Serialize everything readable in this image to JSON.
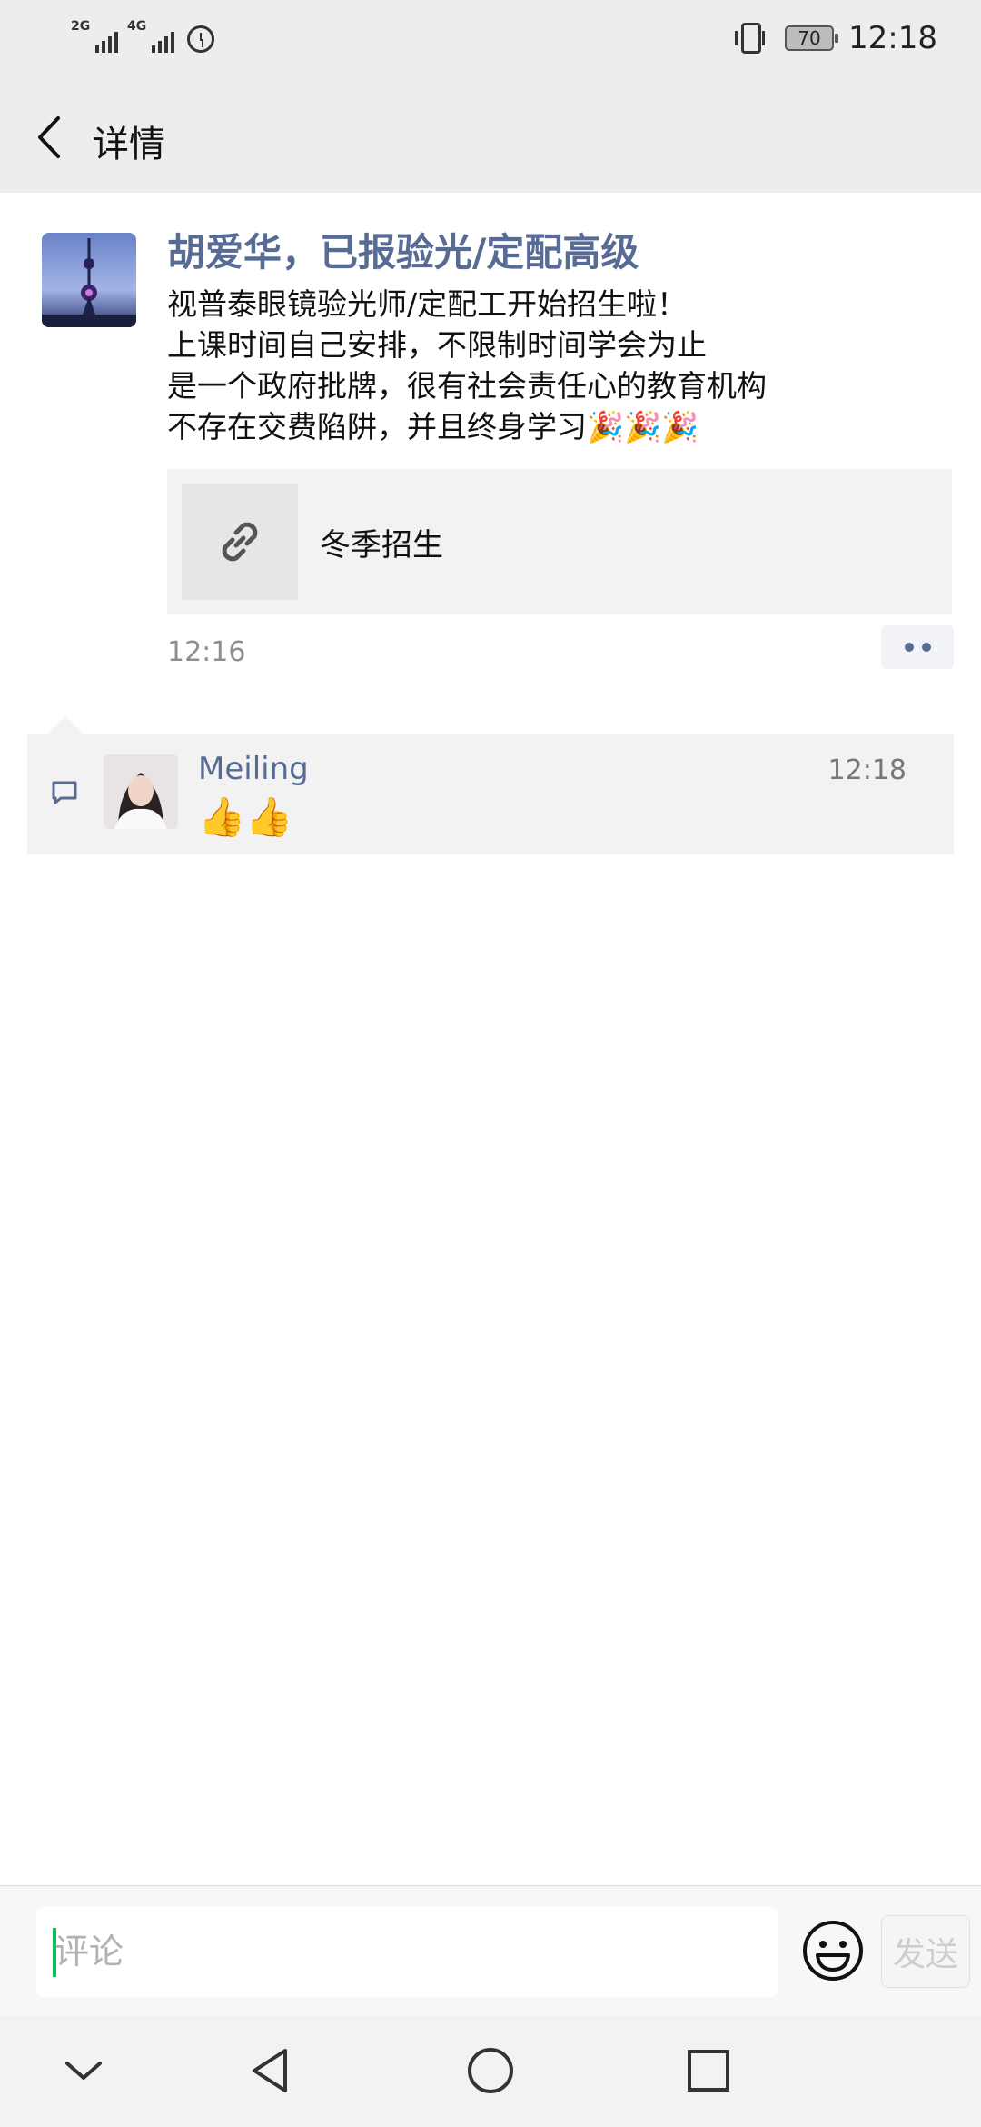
{
  "status_bar": {
    "signal1_label": "2G",
    "signal2_label": "4G",
    "battery": "70",
    "time": "12:18"
  },
  "nav": {
    "title": "详情"
  },
  "post": {
    "author": "胡爱华，已报验光/定配高级",
    "text": "视普泰眼镜验光师/定配工开始招生啦！\n上课时间自己安排，不限制时间学会为止\n是一个政府批牌，很有社会责任心的教育机构\n不存在交费陷阱，并且终身学习🎉🎉🎉",
    "link_title": "冬季招生",
    "time": "12:16"
  },
  "comments": [
    {
      "name": "Meiling",
      "time": "12:18",
      "text": "👍👍"
    }
  ],
  "input_bar": {
    "placeholder": "评论",
    "send_label": "发送"
  },
  "colors": {
    "link_blue": "#576b95",
    "accent_green": "#07c160",
    "bar_gray": "#ededed"
  },
  "icons": [
    "back-icon",
    "link-icon",
    "more-icon",
    "comment-icon",
    "emoji-icon",
    "chevron-down-icon",
    "back-triangle-icon",
    "home-circle-icon",
    "recents-square-icon",
    "alarm-icon",
    "vibrate-icon"
  ]
}
